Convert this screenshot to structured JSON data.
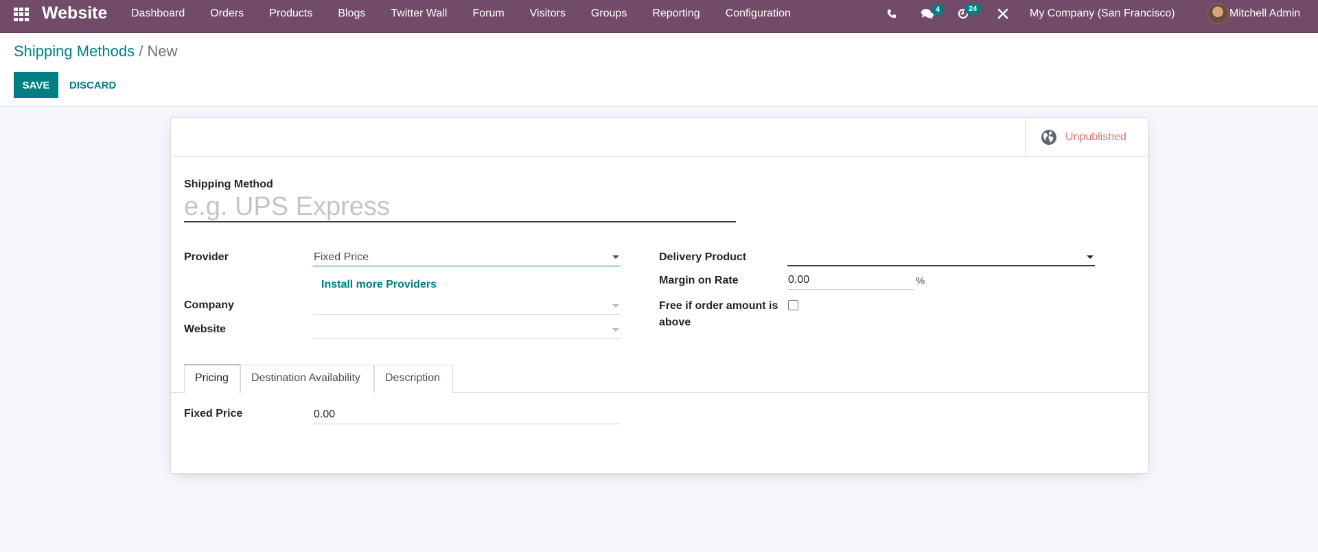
{
  "navbar": {
    "brand": "Website",
    "menu": [
      "Dashboard",
      "Orders",
      "Products",
      "Blogs",
      "Twitter Wall",
      "Forum",
      "Visitors",
      "Groups",
      "Reporting",
      "Configuration"
    ],
    "messages_count": "4",
    "activities_count": "24",
    "company": "My Company (San Francisco)",
    "user": "Mitchell Admin"
  },
  "breadcrumb": {
    "parent": "Shipping Methods",
    "separator": "/",
    "current": "New"
  },
  "buttons": {
    "save": "SAVE",
    "discard": "DISCARD"
  },
  "status": {
    "publish_label": "Unpublished",
    "color": "#e46f78"
  },
  "form": {
    "title_label": "Shipping Method",
    "title_placeholder": "e.g. UPS Express",
    "title_value": "",
    "provider_label": "Provider",
    "provider_value": "Fixed Price",
    "install_link": "Install more Providers",
    "company_label": "Company",
    "company_value": "",
    "website_label": "Website",
    "website_value": "",
    "delivery_product_label": "Delivery Product",
    "delivery_product_value": "",
    "margin_label": "Margin on Rate",
    "margin_value": "0.00",
    "margin_suffix": "%",
    "free_label": "Free if order amount is above",
    "free_checked": false
  },
  "tabs": [
    "Pricing",
    "Destination Availability",
    "Description"
  ],
  "pricing": {
    "fixed_price_label": "Fixed Price",
    "fixed_price_value": "0.00"
  },
  "colors": {
    "brand": "#714b67",
    "accent": "#017e84"
  }
}
